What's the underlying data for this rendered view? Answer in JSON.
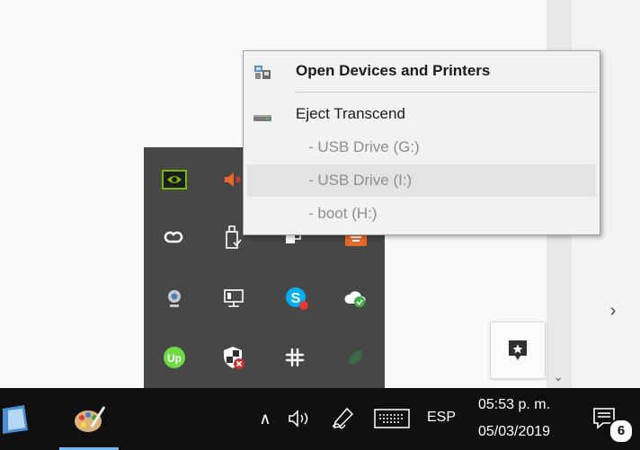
{
  "context_menu": {
    "open_devices_printers": "Open Devices and Printers",
    "eject_transcend": "Eject Transcend",
    "drives": [
      {
        "label": "-   USB Drive (G:)"
      },
      {
        "label": "-   USB Drive (I:)"
      },
      {
        "label": "-   boot (H:)"
      }
    ]
  },
  "taskbar": {
    "language": "ESP",
    "time": "05:53 p. m.",
    "date": "05/03/2019",
    "notification_count": "6"
  },
  "tray_icons": [
    "nvidia-icon",
    "volume-muted-icon",
    "creative-cloud-icon",
    "usb-safely-remove-icon",
    "usb-device-icon",
    "app-orange-icon",
    "webcam-icon",
    "network-icon",
    "skype-icon",
    "cloud-sync-icon",
    "upwork-icon",
    "security-shield-icon",
    "slack-icon",
    "app-green-icon"
  ],
  "colors": {
    "taskbar_bg": "#101010",
    "tray_bg": "#474747",
    "menu_bg": "#f2f2f2",
    "highlight": "#e3e3e3",
    "accent": "#76b9ed"
  }
}
